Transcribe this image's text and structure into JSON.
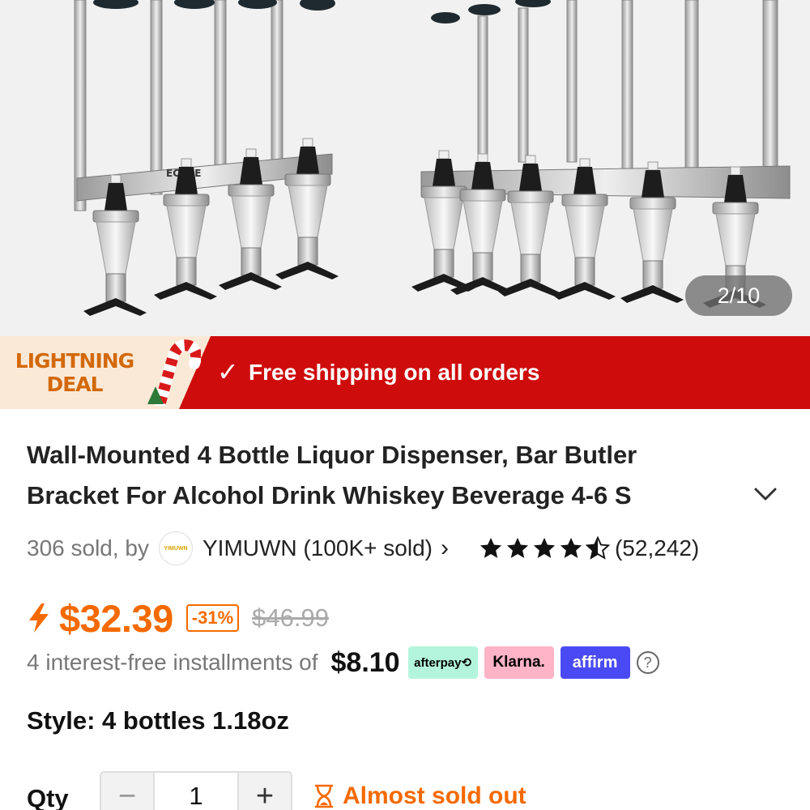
{
  "gallery": {
    "counter": "2/10",
    "brand_mark": "ECHEE"
  },
  "banner": {
    "badge_line1": "LIGHTNING",
    "badge_line2": "DEAL",
    "shipping_text": "Free shipping on all orders",
    "check_glyph": "✓",
    "color": "#cf0c0c"
  },
  "product": {
    "title_line1": "Wall-Mounted 4 Bottle Liquor Dispenser, Bar Butler",
    "title_line2": "Bracket For Alcohol Drink Whiskey Beverage 4-6 S",
    "expand_icon": "chevron-down-icon"
  },
  "seller": {
    "sold_text": "306 sold, by",
    "logo_text": "YIMUWN",
    "store_name": "YIMUWN (100K+ sold)",
    "arrow": "›",
    "rating": 4.5,
    "review_count": "(52,242)"
  },
  "price": {
    "current": "$32.39",
    "discount": "-31%",
    "original": "$46.99",
    "accent": "#f56a00"
  },
  "installments": {
    "text": "4 interest-free installments of",
    "amount": "$8.10",
    "afterpay": "afterpay⟲",
    "klarna": "Klarna.",
    "affirm": "affirm",
    "help": "?"
  },
  "style": {
    "text": "Style: 4 bottles 1.18oz"
  },
  "quantity": {
    "label": "Qty",
    "minus": "−",
    "value": "1",
    "plus": "+",
    "stock_text": "Almost sold out"
  }
}
